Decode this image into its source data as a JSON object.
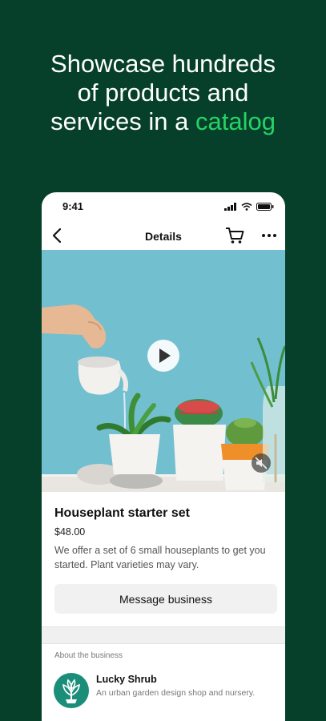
{
  "headline": {
    "line1": "Showcase hundreds",
    "line2": "of products and",
    "line3_prefix": "services in a ",
    "line3_accent": "catalog"
  },
  "status_bar": {
    "time": "9:41"
  },
  "nav": {
    "title": "Details",
    "back_icon": "chevron-left-icon",
    "cart_icon": "cart-icon",
    "more_icon": "more-icon"
  },
  "product": {
    "title": "Houseplant starter set",
    "price": "$48.00",
    "description": "We offer a set of 6 small houseplants to get you started. Plant varieties may vary.",
    "button_label": "Message business"
  },
  "business": {
    "section_label": "About the business",
    "name": "Lucky Shrub",
    "description": "An urban garden design shop and nursery."
  },
  "colors": {
    "background": "#06402b",
    "accent": "#25d366",
    "media_bg": "#72bfcf"
  }
}
